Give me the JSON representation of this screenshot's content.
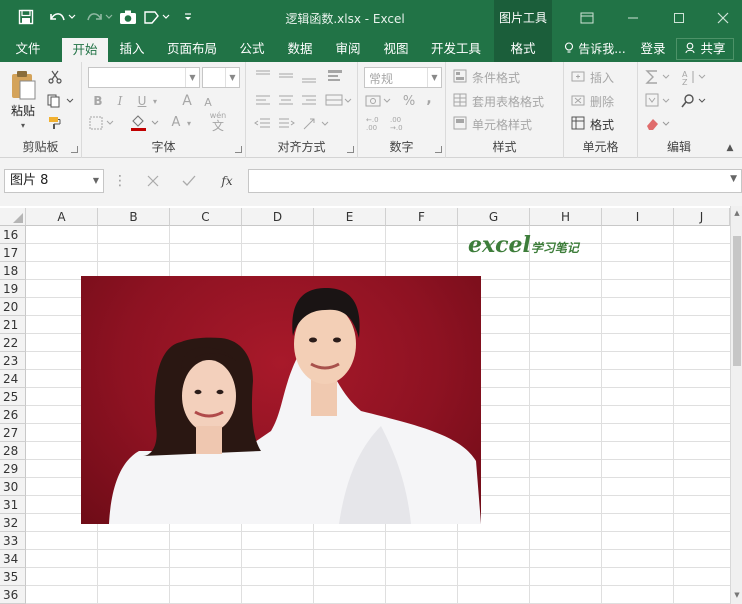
{
  "window": {
    "title": "逻辑函数.xlsx - Excel",
    "context_tool": "图片工具"
  },
  "tabs": [
    "文件",
    "开始",
    "插入",
    "页面布局",
    "公式",
    "数据",
    "审阅",
    "视图",
    "开发工具",
    "格式"
  ],
  "active_tab": "开始",
  "tell_me": "告诉我...",
  "login": "登录",
  "share": "共享",
  "ribbon": {
    "clipboard": {
      "label": "剪贴板",
      "paste": "粘贴"
    },
    "font": {
      "label": "字体",
      "bold": "B",
      "italic": "I",
      "underline": "U",
      "grow": "A",
      "shrink": "A",
      "color_a": "A",
      "wen": "wén",
      "wen_char": "文"
    },
    "alignment": {
      "label": "对齐方式"
    },
    "number": {
      "label": "数字",
      "format": "常规",
      "percent": "%",
      "comma": ","
    },
    "styles": {
      "label": "样式",
      "conditional": "条件格式",
      "table": "套用表格格式",
      "cell": "单元格样式"
    },
    "cells": {
      "label": "单元格",
      "insert": "插入",
      "delete": "删除",
      "format": "格式"
    },
    "editing": {
      "label": "编辑"
    }
  },
  "name_box": "图片 8",
  "fx": "fx",
  "columns": [
    "A",
    "B",
    "C",
    "D",
    "E",
    "F",
    "G",
    "H",
    "I",
    "J"
  ],
  "rows": [
    "16",
    "17",
    "18",
    "19",
    "20",
    "21",
    "22",
    "23",
    "24",
    "25",
    "26",
    "27",
    "28",
    "29",
    "30",
    "31",
    "32",
    "33",
    "34",
    "35",
    "36"
  ],
  "watermark": {
    "brand": "excel",
    "sub": "学习笔记"
  },
  "colors": {
    "excel_green": "#217346",
    "ribbon_bg": "#f3f3f3",
    "photo_bg": "#8e1222"
  }
}
